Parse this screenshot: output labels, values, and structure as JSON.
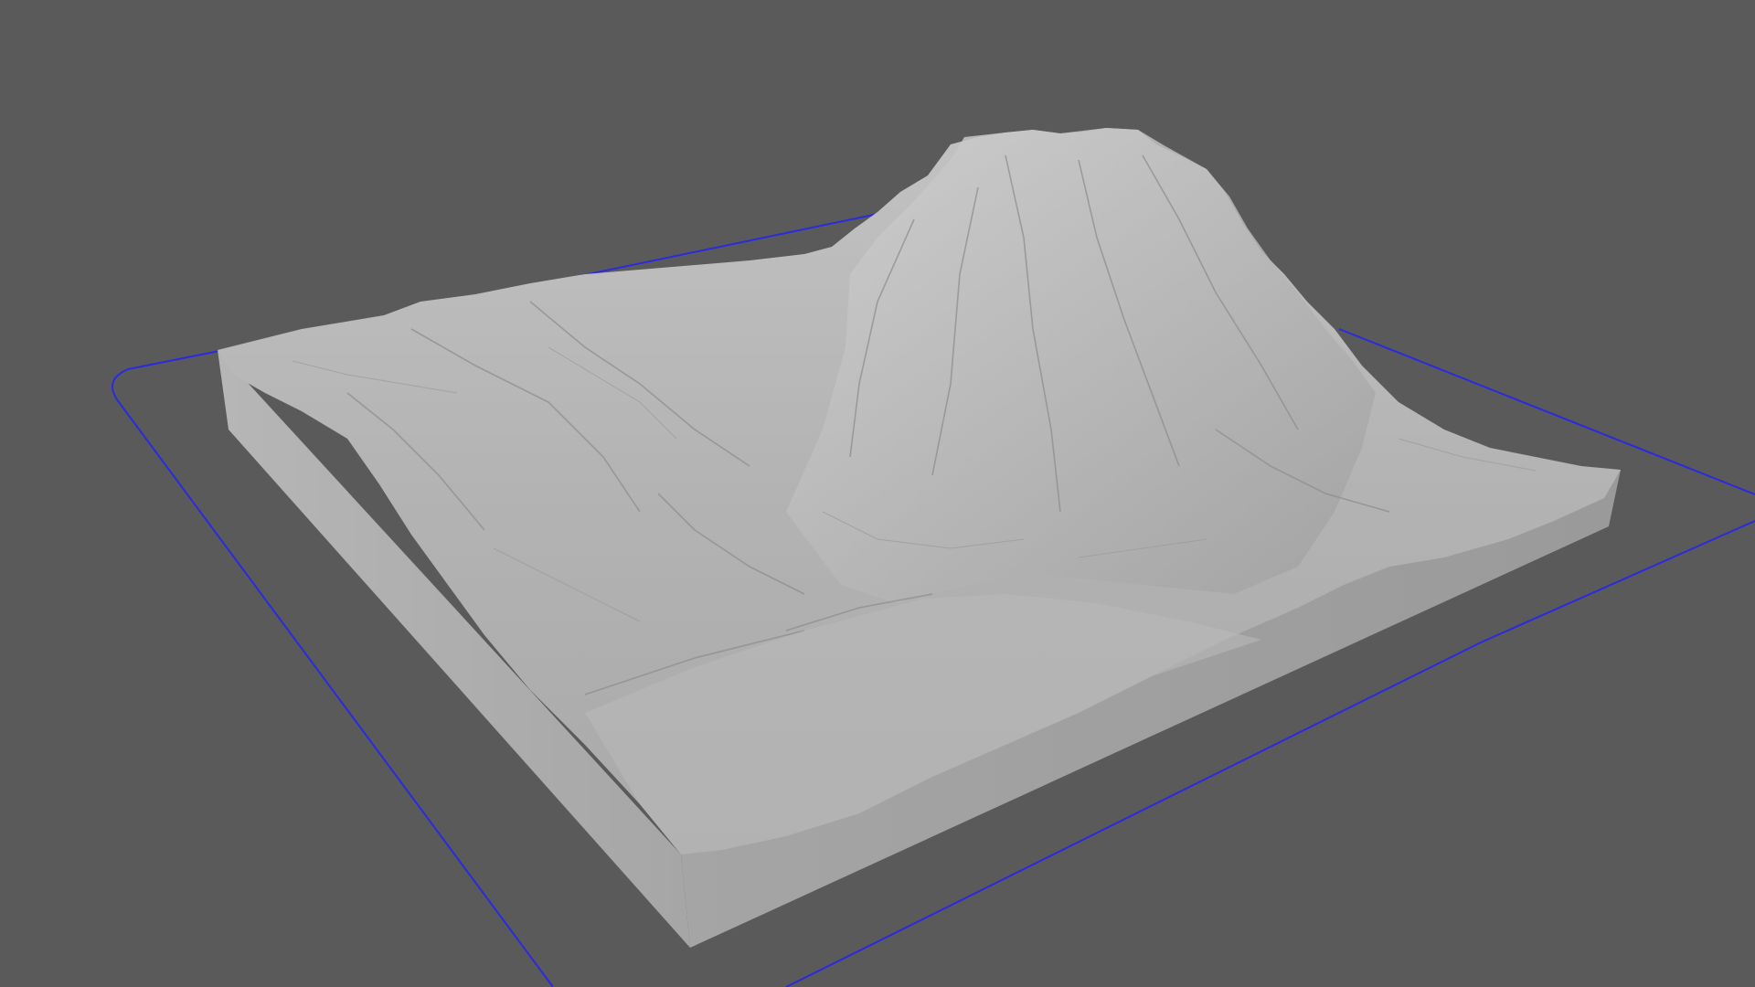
{
  "viewport": {
    "background_color": "#5a5a5a",
    "bounding_outline_color": "#2a2adf",
    "model": {
      "kind": "terrain-relief-model",
      "surface_color": "#b4b4b4",
      "side_color": "#9e9e9e",
      "front_color": "#a8a8a8"
    }
  }
}
